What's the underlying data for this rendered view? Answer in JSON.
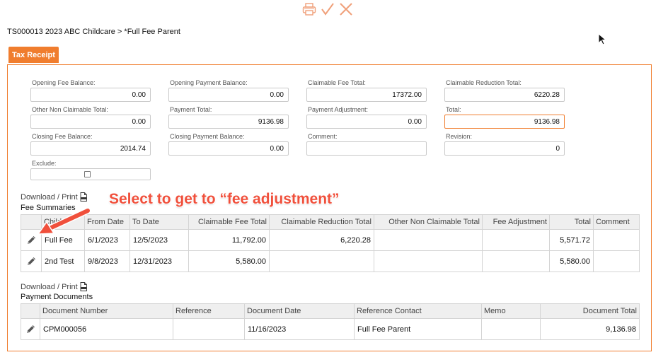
{
  "header": {
    "breadcrumb": "TS000013 2023 ABC Childcare > *Full Fee Parent"
  },
  "toolbar": {
    "icons": [
      "printer-icon",
      "checkmark-icon",
      "close-icon"
    ],
    "accent_color": "#f07d2e"
  },
  "tab": {
    "label": "Tax Receipt"
  },
  "fields": {
    "opening_fee_balance": {
      "label": "Opening Fee Balance:",
      "value": "0.00"
    },
    "opening_payment_balance": {
      "label": "Opening Payment Balance:",
      "value": "0.00"
    },
    "claimable_fee_total": {
      "label": "Claimable Fee Total:",
      "value": "17372.00"
    },
    "claimable_reduction_total": {
      "label": "Claimable Reduction Total:",
      "value": "6220.28"
    },
    "other_non_claimable_total": {
      "label": "Other Non Claimable Total:",
      "value": "0.00"
    },
    "payment_total": {
      "label": "Payment Total:",
      "value": "9136.98"
    },
    "payment_adjustment": {
      "label": "Payment Adjustment:",
      "value": "0.00"
    },
    "total": {
      "label": "Total:",
      "value": "9136.98"
    },
    "closing_fee_balance": {
      "label": "Closing Fee Balance:",
      "value": "2014.74"
    },
    "closing_payment_balance": {
      "label": "Closing Payment Balance:",
      "value": "0.00"
    },
    "comment": {
      "label": "Comment:",
      "value": ""
    },
    "revision": {
      "label": "Revision:",
      "value": "0"
    },
    "exclude": {
      "label": "Exclude:",
      "checked": false
    }
  },
  "fee_summaries": {
    "download_label": "Download / Print",
    "title": "Fee Summaries",
    "columns": [
      "Child",
      "From Date",
      "To Date",
      "Claimable Fee Total",
      "Claimable Reduction Total",
      "Other Non Claimable Total",
      "Fee Adjustment",
      "Total",
      "Comment"
    ],
    "rows": [
      {
        "child": "Full Fee",
        "from": "6/1/2023",
        "to": "12/5/2023",
        "claimable_fee": "11,792.00",
        "claimable_reduction": "6,220.28",
        "other": "",
        "fee_adj": "",
        "total": "5,571.72",
        "comment": ""
      },
      {
        "child": "2nd Test",
        "from": "9/8/2023",
        "to": "12/31/2023",
        "claimable_fee": "5,580.00",
        "claimable_reduction": "",
        "other": "",
        "fee_adj": "",
        "total": "5,580.00",
        "comment": ""
      }
    ]
  },
  "payment_documents": {
    "download_label": "Download / Print",
    "title": "Payment Documents",
    "columns": [
      "Document Number",
      "Reference",
      "Document Date",
      "Reference Contact",
      "Memo",
      "Document Total"
    ],
    "rows": [
      {
        "doc_number": "CPM000056",
        "reference": "",
        "doc_date": "11/16/2023",
        "ref_contact": "Full Fee Parent",
        "memo": "",
        "doc_total": "9,136.98"
      }
    ]
  },
  "annotation": {
    "text": "Select to get to “fee adjustment”",
    "color": "#f0503c"
  }
}
